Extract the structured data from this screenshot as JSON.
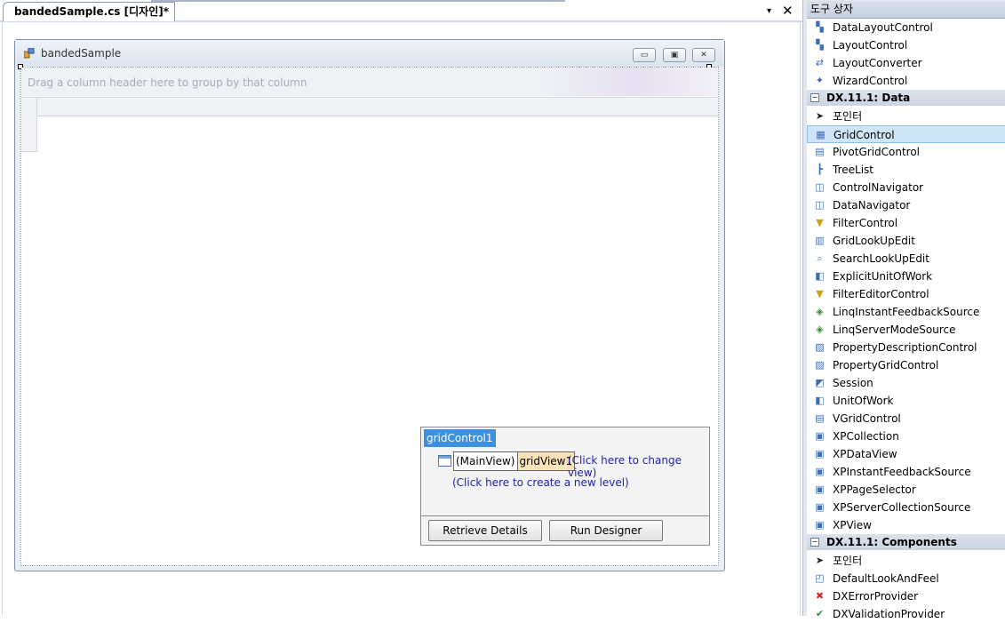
{
  "document": {
    "tab_label": "bandedSample.cs [디자인]*",
    "dropdown_glyph": "▾",
    "close_glyph": "✕"
  },
  "form": {
    "title": "bandedSample",
    "buttons": {
      "minimize": "▭",
      "maximize": "▣",
      "close": "✕"
    }
  },
  "grid": {
    "group_panel_hint": "Drag a column header here to group by that column"
  },
  "smart_tag": {
    "title": "gridControl1",
    "main_view_label": "(MainView)",
    "view_name": "gridView1",
    "change_view_link": "(Click here to change view)",
    "new_level_link": "(Click here to create a new level)",
    "retrieve_button": "Retrieve Details",
    "designer_button": "Run Designer"
  },
  "toolbox": {
    "title": "도구 상자",
    "entries": [
      {
        "type": "item",
        "label": "DataLayoutControl",
        "icon": "layout-icon"
      },
      {
        "type": "item",
        "label": "LayoutControl",
        "icon": "layout-icon"
      },
      {
        "type": "item",
        "label": "LayoutConverter",
        "icon": "converter-icon"
      },
      {
        "type": "item",
        "label": "WizardControl",
        "icon": "wizard-icon"
      },
      {
        "type": "category",
        "label": "DX.11.1: Data",
        "toggle": "−"
      },
      {
        "type": "item",
        "label": "포인터",
        "icon": "pointer-icon"
      },
      {
        "type": "item",
        "label": "GridControl",
        "icon": "grid-icon",
        "selected": true
      },
      {
        "type": "item",
        "label": "PivotGridControl",
        "icon": "pivot-icon"
      },
      {
        "type": "item",
        "label": "TreeList",
        "icon": "tree-icon"
      },
      {
        "type": "item",
        "label": "ControlNavigator",
        "icon": "navigator-icon"
      },
      {
        "type": "item",
        "label": "DataNavigator",
        "icon": "navigator-icon"
      },
      {
        "type": "item",
        "label": "FilterControl",
        "icon": "filter-icon"
      },
      {
        "type": "item",
        "label": "GridLookUpEdit",
        "icon": "lookup-icon"
      },
      {
        "type": "item",
        "label": "SearchLookUpEdit",
        "icon": "search-lookup-icon"
      },
      {
        "type": "item",
        "label": "ExplicitUnitOfWork",
        "icon": "unit-of-work-icon"
      },
      {
        "type": "item",
        "label": "FilterEditorControl",
        "icon": "filter-icon"
      },
      {
        "type": "item",
        "label": "LinqInstantFeedbackSource",
        "icon": "linq-icon"
      },
      {
        "type": "item",
        "label": "LinqServerModeSource",
        "icon": "linq-icon"
      },
      {
        "type": "item",
        "label": "PropertyDescriptionControl",
        "icon": "property-icon"
      },
      {
        "type": "item",
        "label": "PropertyGridControl",
        "icon": "property-grid-icon"
      },
      {
        "type": "item",
        "label": "Session",
        "icon": "session-icon"
      },
      {
        "type": "item",
        "label": "UnitOfWork",
        "icon": "unit-of-work-icon"
      },
      {
        "type": "item",
        "label": "VGridControl",
        "icon": "vgrid-icon"
      },
      {
        "type": "item",
        "label": "XPCollection",
        "icon": "xp-icon"
      },
      {
        "type": "item",
        "label": "XPDataView",
        "icon": "xp-icon"
      },
      {
        "type": "item",
        "label": "XPInstantFeedbackSource",
        "icon": "xp-icon"
      },
      {
        "type": "item",
        "label": "XPPageSelector",
        "icon": "xp-icon"
      },
      {
        "type": "item",
        "label": "XPServerCollectionSource",
        "icon": "xp-icon"
      },
      {
        "type": "item",
        "label": "XPView",
        "icon": "xp-icon"
      },
      {
        "type": "category",
        "label": "DX.11.1: Components",
        "toggle": "−"
      },
      {
        "type": "item",
        "label": "포인터",
        "icon": "pointer-icon"
      },
      {
        "type": "item",
        "label": "DefaultLookAndFeel",
        "icon": "look-and-feel-icon"
      },
      {
        "type": "item",
        "label": "DXErrorProvider",
        "icon": "error-icon"
      },
      {
        "type": "item",
        "label": "DXValidationProvider",
        "icon": "validation-icon"
      }
    ]
  }
}
